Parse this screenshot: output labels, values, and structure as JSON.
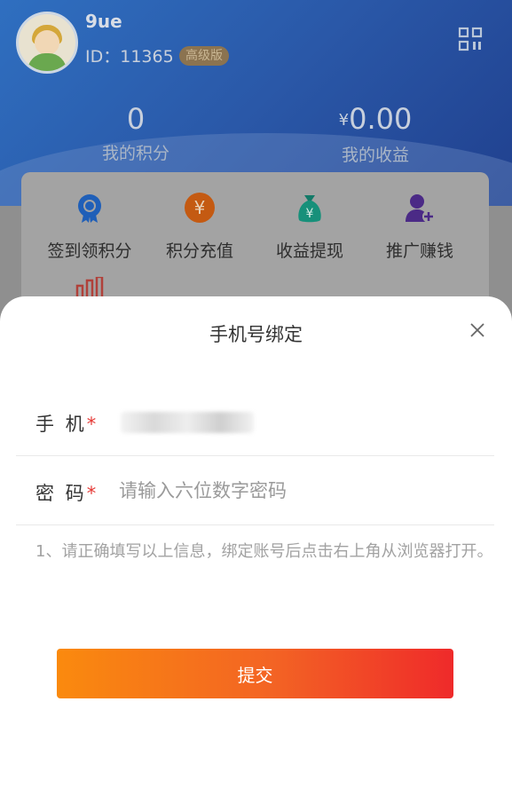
{
  "user": {
    "name": "9ue",
    "id_text": "ID：11365",
    "level": "高级版"
  },
  "stats": {
    "points_value": "0",
    "points_label": "我的积分",
    "earnings_currency": "¥",
    "earnings_value": "0.00",
    "earnings_label": "我的收益"
  },
  "menu": {
    "items": [
      {
        "label": "签到领积分",
        "icon": "award-badge-icon",
        "color": "#1f6fd6"
      },
      {
        "label": "积分充值",
        "icon": "yen-coin-icon",
        "color": "#e8751a"
      },
      {
        "label": "收益提现",
        "icon": "money-bag-icon",
        "color": "#1ea38a"
      },
      {
        "label": "推广赚钱",
        "icon": "add-user-icon",
        "color": "#6a3bb0"
      }
    ]
  },
  "sheet": {
    "title": "手机号绑定",
    "phone_label": "手 机",
    "password_label": "密 码",
    "required_mark": "*",
    "password_placeholder": "请输入六位数字密码",
    "hint": "1、请正确填写以上信息，绑定账号后点击右上角从浏览器打开。",
    "submit_label": "提交"
  },
  "colors": {
    "accent_start": "#fa8a0e",
    "accent_end": "#ef2a2a",
    "required": "#e53935"
  }
}
